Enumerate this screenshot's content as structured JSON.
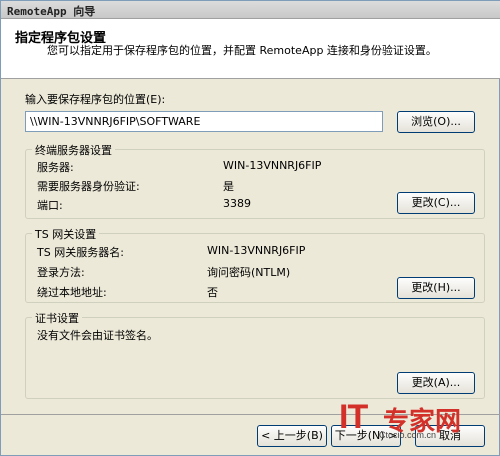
{
  "window": {
    "title": "RemoteApp 向导"
  },
  "header": {
    "title": "指定程序包设置",
    "description": "您可以指定用于保存程序包的位置，并配置 RemoteApp 连接和身份验证设置。"
  },
  "package_location": {
    "label": "输入要保存程序包的位置(E):",
    "value": "\\\\WIN-13VNNRJ6FIP\\SOFTWARE",
    "browse_label": "浏览(O)..."
  },
  "terminal_server": {
    "group_title": "终端服务器设置",
    "server_label": "服务器:",
    "server_value": "WIN-13VNNRJ6FIP",
    "auth_label": "需要服务器身份验证:",
    "auth_value": "是",
    "port_label": "端口:",
    "port_value": "3389",
    "change_label": "更改(C)..."
  },
  "ts_gateway": {
    "group_title": "TS 网关设置",
    "server_name_label": "TS 网关服务器名:",
    "server_name_value": "WIN-13VNNRJ6FIP",
    "login_label": "登录方法:",
    "login_value": "询问密码(NTLM)",
    "bypass_label": "绕过本地地址:",
    "bypass_value": "否",
    "change_label": "更改(H)..."
  },
  "certificate": {
    "group_title": "证书设置",
    "message": "没有文件会由证书签名。",
    "change_label": "更改(A)..."
  },
  "footer": {
    "back_label": "< 上一步(B)",
    "next_label": "下一步(N) >",
    "cancel_label": "取消"
  },
  "watermark": {
    "brand_it": "IT",
    "brand_cn": "专家网",
    "url": "Ctocio.com.cn"
  }
}
